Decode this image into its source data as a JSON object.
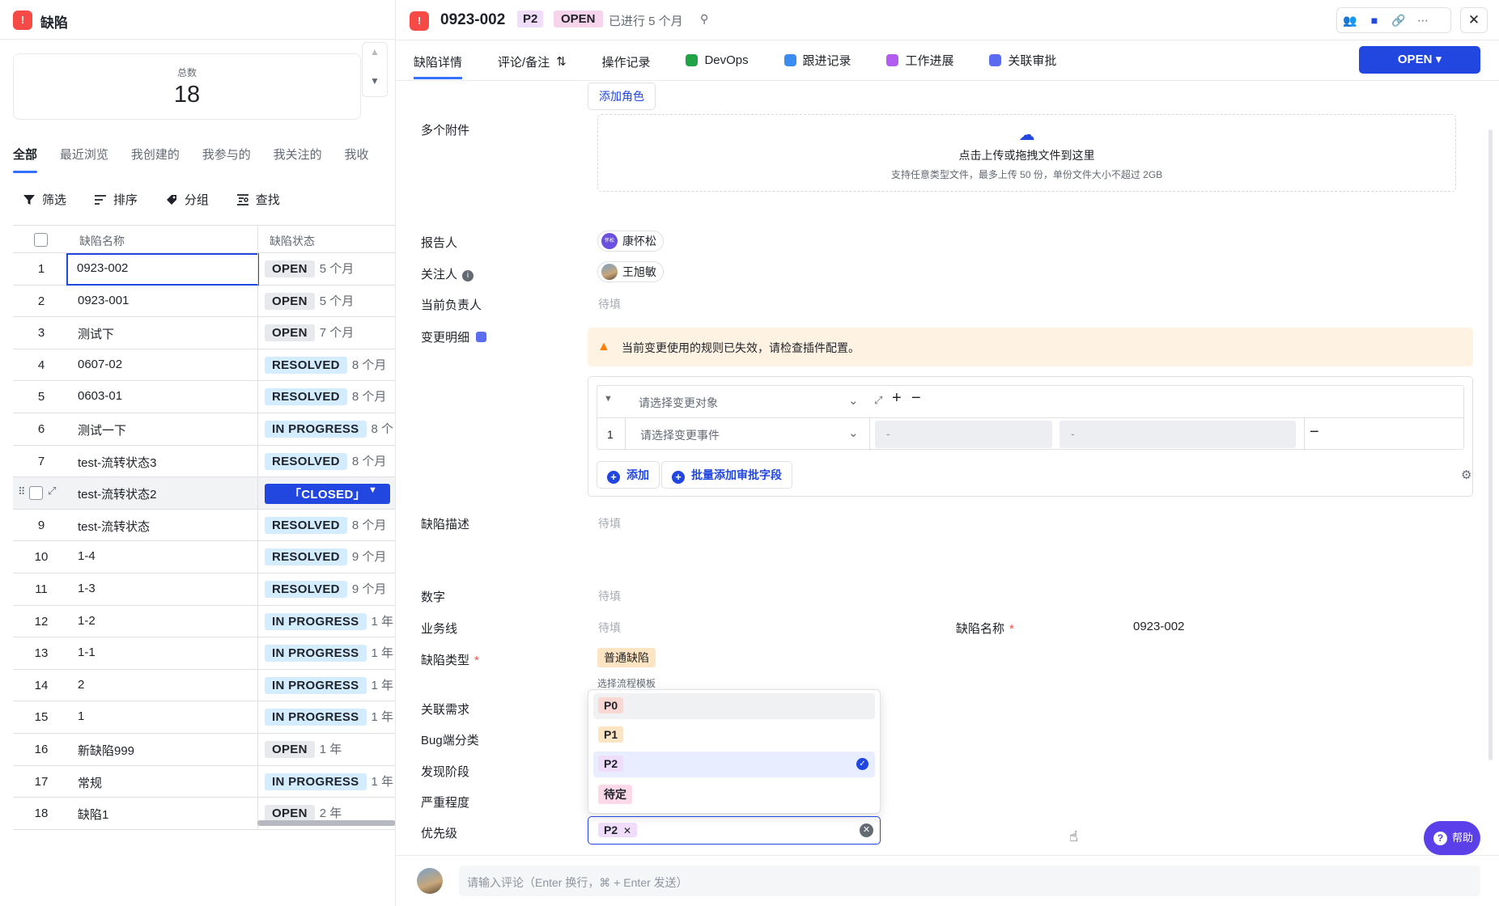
{
  "left": {
    "title": "缺陷",
    "stats": {
      "label": "总数",
      "value": "18"
    },
    "view_tabs": [
      "全部",
      "最近浏览",
      "我创建的",
      "我参与的",
      "我关注的",
      "我收"
    ],
    "toolbar": {
      "filter": "筛选",
      "sort": "排序",
      "group": "分组",
      "find": "查找"
    },
    "table": {
      "headers": {
        "name": "缺陷名称",
        "status": "缺陷状态"
      },
      "rows": [
        {
          "num": "1",
          "name": "0923-002",
          "status": "OPEN",
          "age": "5 个月",
          "kind": "open"
        },
        {
          "num": "2",
          "name": "0923-001",
          "status": "OPEN",
          "age": "5 个月",
          "kind": "open"
        },
        {
          "num": "3",
          "name": "测试下",
          "status": "OPEN",
          "age": "7 个月",
          "kind": "open"
        },
        {
          "num": "4",
          "name": "0607-02",
          "status": "RESOLVED",
          "age": "8 个月",
          "kind": "resolved"
        },
        {
          "num": "5",
          "name": "0603-01",
          "status": "RESOLVED",
          "age": "8 个月",
          "kind": "resolved"
        },
        {
          "num": "6",
          "name": "测试一下",
          "status": "IN PROGRESS",
          "age": "8 个",
          "kind": "progress"
        },
        {
          "num": "7",
          "name": "test-流转状态3",
          "status": "RESOLVED",
          "age": "8 个月",
          "kind": "resolved"
        },
        {
          "num": "",
          "name": "test-流转状态2",
          "status": "「CLOSED」",
          "age": "",
          "kind": "closed"
        },
        {
          "num": "9",
          "name": "test-流转状态",
          "status": "RESOLVED",
          "age": "8 个月",
          "kind": "resolved"
        },
        {
          "num": "10",
          "name": "1-4",
          "status": "RESOLVED",
          "age": "9 个月",
          "kind": "resolved"
        },
        {
          "num": "11",
          "name": "1-3",
          "status": "RESOLVED",
          "age": "9 个月",
          "kind": "resolved"
        },
        {
          "num": "12",
          "name": "1-2",
          "status": "IN PROGRESS",
          "age": "1 年",
          "kind": "progress"
        },
        {
          "num": "13",
          "name": "1-1",
          "status": "IN PROGRESS",
          "age": "1 年",
          "kind": "progress"
        },
        {
          "num": "14",
          "name": "2",
          "status": "IN PROGRESS",
          "age": "1 年",
          "kind": "progress"
        },
        {
          "num": "15",
          "name": "1",
          "status": "IN PROGRESS",
          "age": "1 年",
          "kind": "progress"
        },
        {
          "num": "16",
          "name": "新缺陷999",
          "status": "OPEN",
          "age": "1 年",
          "kind": "open"
        },
        {
          "num": "17",
          "name": "常规",
          "status": "IN PROGRESS",
          "age": "1 年",
          "kind": "progress"
        },
        {
          "num": "18",
          "name": "缺陷1",
          "status": "OPEN",
          "age": "2 年",
          "kind": "open"
        }
      ]
    }
  },
  "right": {
    "header": {
      "id": "0923-002",
      "priority": "P2",
      "state": "OPEN",
      "age": "已进行 5 个月"
    },
    "tabs": [
      "缺陷详情",
      "评论/备注",
      "操作记录",
      "DevOps",
      "跟进记录",
      "工作进展",
      "关联审批"
    ],
    "tab_colors": [
      "",
      "",
      "",
      "#1fa346",
      "#3b8cf0",
      "#b25cf0",
      "#5b6cf0"
    ],
    "open_button": "OPEN ▾",
    "add_role": "添加角色",
    "fields": {
      "attachments": "多个附件",
      "reporter": "报告人",
      "followers": "关注人",
      "assignee": "当前负责人",
      "change_detail": "变更明细",
      "description": "缺陷描述",
      "number": "数字",
      "business_line": "业务线",
      "bug_name": "缺陷名称",
      "bug_type": "缺陷类型",
      "related_req": "关联需求",
      "bug_side": "Bug端分类",
      "phase": "发现阶段",
      "severity": "严重程度",
      "priority": "优先级"
    },
    "placeholder": "待填",
    "upload": {
      "title": "点击上传或拖拽文件到这里",
      "hint": "支持任意类型文件，最多上传 50 份，单份文件大小不超过 2GB"
    },
    "reporter_name": "康怀松",
    "reporter_avatar_text": "怀松",
    "follower_name": "王旭敏",
    "warning": "当前变更使用的规则已失效，请检查插件配置。",
    "change": {
      "object_placeholder": "请选择变更对象",
      "event_placeholder": "请选择变更事件",
      "row_num": "1",
      "dash": "-",
      "add": "添加",
      "bulk_add": "批量添加审批字段"
    },
    "bug_name_value": "0923-002",
    "bug_type_value": "普通缺陷",
    "flow_hint": "选择流程模板",
    "priority_options": [
      {
        "label": "P0",
        "color": "#fbd7d3"
      },
      {
        "label": "P1",
        "color": "#fde4c2"
      },
      {
        "label": "P2",
        "color": "#f0dcfb"
      },
      {
        "label": "待定",
        "color": "#fbd9e8"
      }
    ],
    "priority_selected": "P2",
    "help": "帮助",
    "comment_placeholder": "请输入评论（Enter 换行，⌘ + Enter 发送）"
  }
}
